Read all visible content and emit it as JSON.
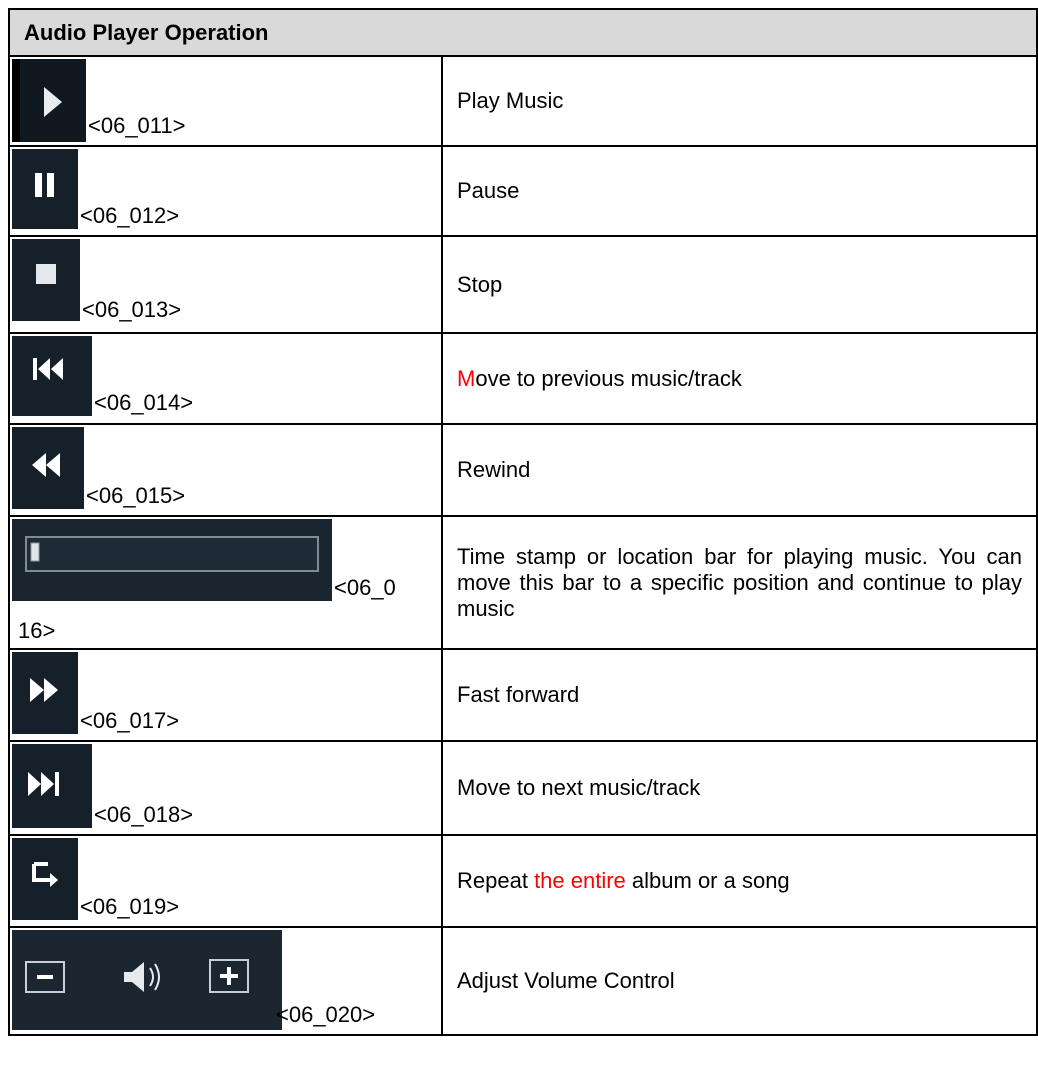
{
  "table": {
    "header": "Audio Player Operation",
    "rows": [
      {
        "code": "<06_011>",
        "icon": "play-icon",
        "desc": "Play Music"
      },
      {
        "code": "<06_012>",
        "icon": "pause-icon",
        "desc": "Pause"
      },
      {
        "code": "<06_013>",
        "icon": "stop-icon",
        "desc": "Stop"
      },
      {
        "code": "<06_014>",
        "icon": "previous-track-icon",
        "desc_hl": "M",
        "desc_rest": "ove to previous music/track"
      },
      {
        "code": "<06_015>",
        "icon": "rewind-icon",
        "desc": "Rewind"
      },
      {
        "code_part1": "<06_0",
        "code_part2": "16>",
        "icon": "location-bar-icon",
        "desc": "Time stamp or location bar for playing music. You can move this bar to a specific position and continue to play music"
      },
      {
        "code": "<06_017>",
        "icon": "fast-forward-icon",
        "desc": "Fast forward"
      },
      {
        "code": "<06_018>",
        "icon": "next-track-icon",
        "desc": "Move to next music/track"
      },
      {
        "code": "<06_019>",
        "icon": "repeat-icon",
        "desc_pre": "Repeat ",
        "desc_hl": "the entire",
        "desc_post": " album or a song"
      },
      {
        "code": "<06_020>",
        "icon": "volume-control-icon",
        "desc": "Adjust Volume Control"
      }
    ]
  },
  "colors": {
    "icon_bg": "#15202a",
    "highlight": "#ff0000",
    "header_bg": "#d9d9d9"
  }
}
